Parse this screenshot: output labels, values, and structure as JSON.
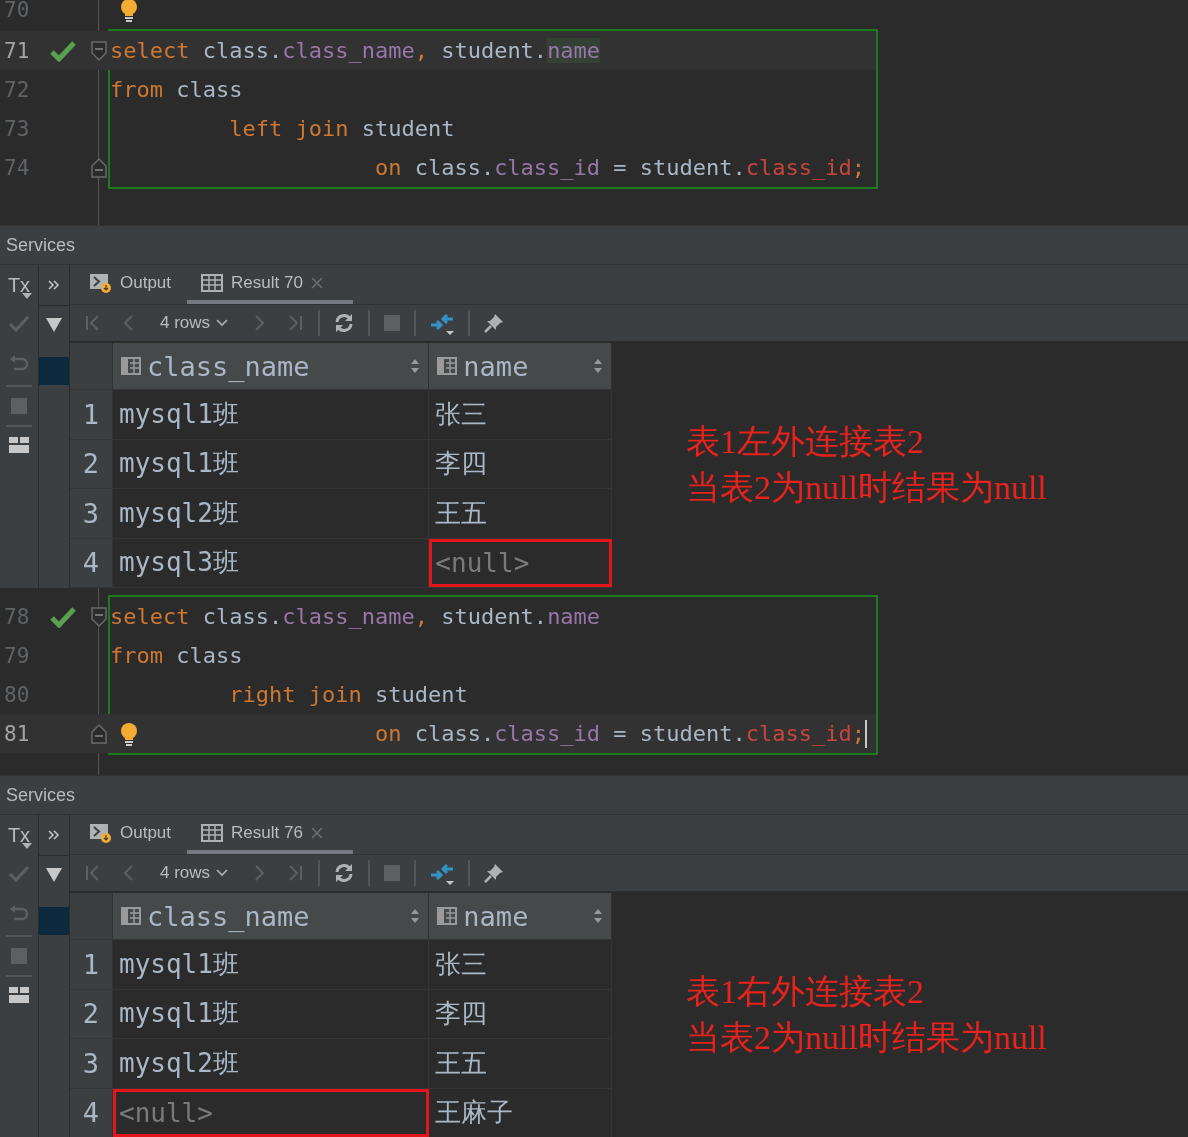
{
  "panels": [
    {
      "editor": {
        "before": [
          {
            "number": "70",
            "current": false,
            "executed": false,
            "hint": true,
            "fold_open": false,
            "fold_close": false,
            "caret": false
          }
        ],
        "statement": {
          "highlighted": true,
          "lines": [
            {
              "number": "71",
              "current": true,
              "executed": true,
              "hint": false,
              "fold_open": true,
              "fold_close": false,
              "caret": false,
              "tokens": [
                {
                  "kind": "keyword",
                  "text": "select"
                },
                {
                  "kind": "plain",
                  "text": " class."
                },
                {
                  "kind": "field",
                  "text": "class_name"
                },
                {
                  "kind": "keyword",
                  "text": ","
                },
                {
                  "kind": "plain",
                  "text": " student."
                },
                {
                  "kind": "field",
                  "text": "name",
                  "highlighted": true
                }
              ]
            },
            {
              "number": "72",
              "current": false,
              "executed": false,
              "hint": false,
              "fold_open": false,
              "fold_close": false,
              "caret": false,
              "tokens": [
                {
                  "kind": "keyword",
                  "text": "from"
                },
                {
                  "kind": "plain",
                  "text": " class"
                }
              ]
            },
            {
              "number": "73",
              "current": false,
              "executed": false,
              "hint": false,
              "fold_open": false,
              "fold_close": false,
              "caret": false,
              "tokens": [
                {
                  "kind": "keyword",
                  "text": "         left join"
                },
                {
                  "kind": "plain",
                  "text": " student"
                }
              ]
            },
            {
              "number": "74",
              "current": false,
              "executed": false,
              "hint": false,
              "fold_open": false,
              "fold_close": true,
              "caret": false,
              "tokens": [
                {
                  "kind": "keyword",
                  "text": "                    on"
                },
                {
                  "kind": "plain",
                  "text": " class."
                },
                {
                  "kind": "field",
                  "text": "class_id"
                },
                {
                  "kind": "plain",
                  "text": " = student."
                },
                {
                  "kind": "unresolved",
                  "text": "class_id"
                },
                {
                  "kind": "keyword",
                  "text": ";"
                }
              ]
            }
          ]
        }
      },
      "services": {
        "title": "Services",
        "side_label": "Tx",
        "tabs": [
          {
            "label": "Output",
            "kind": "output",
            "selected": false
          },
          {
            "label": "Result 70",
            "kind": "result",
            "selected": true
          }
        ],
        "toolbar": [
          {
            "kind": "first",
            "disabled": true
          },
          {
            "kind": "prev",
            "disabled": true
          },
          {
            "kind": "rows",
            "label": "4 rows",
            "disabled": false
          },
          {
            "kind": "next",
            "disabled": true
          },
          {
            "kind": "last",
            "disabled": true
          },
          {
            "kind": "refresh",
            "disabled": false
          },
          {
            "kind": "stop",
            "disabled": true
          },
          {
            "kind": "compare",
            "disabled": false
          },
          {
            "kind": "pin",
            "disabled": false
          }
        ],
        "table": {
          "columns": [
            "class_name",
            "name"
          ],
          "rows": [
            {
              "number": "1",
              "cells": [
                {
                  "text": "mysql1班",
                  "kind": "value",
                  "marked": false
                },
                {
                  "text": "张三",
                  "kind": "value",
                  "marked": false
                }
              ]
            },
            {
              "number": "2",
              "cells": [
                {
                  "text": "mysql1班",
                  "kind": "value",
                  "marked": false
                },
                {
                  "text": "李四",
                  "kind": "value",
                  "marked": false
                }
              ]
            },
            {
              "number": "3",
              "cells": [
                {
                  "text": "mysql2班",
                  "kind": "value",
                  "marked": false
                },
                {
                  "text": "王五",
                  "kind": "value",
                  "marked": false
                }
              ]
            },
            {
              "number": "4",
              "cells": [
                {
                  "text": "mysql3班",
                  "kind": "value",
                  "marked": false
                },
                {
                  "text": "<null>",
                  "kind": "null",
                  "marked": true
                }
              ]
            }
          ]
        },
        "annotation": [
          "表1左外连接表2",
          "当表2为null时结果为null"
        ]
      }
    },
    {
      "editor": {
        "statement": {
          "highlighted": true,
          "lines": [
            {
              "number": "78",
              "current": false,
              "executed": true,
              "hint": false,
              "fold_open": true,
              "fold_close": false,
              "caret": false,
              "tokens": [
                {
                  "kind": "keyword",
                  "text": "select"
                },
                {
                  "kind": "plain",
                  "text": " class."
                },
                {
                  "kind": "field",
                  "text": "class_name"
                },
                {
                  "kind": "keyword",
                  "text": ","
                },
                {
                  "kind": "plain",
                  "text": " student."
                },
                {
                  "kind": "field",
                  "text": "name"
                }
              ]
            },
            {
              "number": "79",
              "current": false,
              "executed": false,
              "hint": false,
              "fold_open": false,
              "fold_close": false,
              "caret": false,
              "tokens": [
                {
                  "kind": "keyword",
                  "text": "from"
                },
                {
                  "kind": "plain",
                  "text": " class"
                }
              ]
            },
            {
              "number": "80",
              "current": false,
              "executed": false,
              "hint": false,
              "fold_open": false,
              "fold_close": false,
              "caret": false,
              "tokens": [
                {
                  "kind": "keyword",
                  "text": "         right join"
                },
                {
                  "kind": "plain",
                  "text": " student"
                }
              ]
            },
            {
              "number": "81",
              "current": true,
              "executed": false,
              "hint": true,
              "fold_open": false,
              "fold_close": true,
              "caret": true,
              "tokens": [
                {
                  "kind": "keyword",
                  "text": "                    on"
                },
                {
                  "kind": "plain",
                  "text": " class."
                },
                {
                  "kind": "field",
                  "text": "class_id"
                },
                {
                  "kind": "plain",
                  "text": " = student."
                },
                {
                  "kind": "unresolved",
                  "text": "class_id"
                },
                {
                  "kind": "keyword",
                  "text": ";"
                }
              ]
            }
          ]
        }
      },
      "services": {
        "title": "Services",
        "side_label": "Tx",
        "tabs": [
          {
            "label": "Output",
            "kind": "output",
            "selected": false
          },
          {
            "label": "Result 76",
            "kind": "result",
            "selected": true
          }
        ],
        "toolbar": [
          {
            "kind": "first",
            "disabled": true
          },
          {
            "kind": "prev",
            "disabled": true
          },
          {
            "kind": "rows",
            "label": "4 rows",
            "disabled": false
          },
          {
            "kind": "next",
            "disabled": true
          },
          {
            "kind": "last",
            "disabled": true
          },
          {
            "kind": "refresh",
            "disabled": false
          },
          {
            "kind": "stop",
            "disabled": true
          },
          {
            "kind": "compare",
            "disabled": false
          },
          {
            "kind": "pin",
            "disabled": false
          }
        ],
        "table": {
          "columns": [
            "class_name",
            "name"
          ],
          "rows": [
            {
              "number": "1",
              "cells": [
                {
                  "text": "mysql1班",
                  "kind": "value",
                  "marked": false
                },
                {
                  "text": "张三",
                  "kind": "value",
                  "marked": false
                }
              ]
            },
            {
              "number": "2",
              "cells": [
                {
                  "text": "mysql1班",
                  "kind": "value",
                  "marked": false
                },
                {
                  "text": "李四",
                  "kind": "value",
                  "marked": false
                }
              ]
            },
            {
              "number": "3",
              "cells": [
                {
                  "text": "mysql2班",
                  "kind": "value",
                  "marked": false
                },
                {
                  "text": "王五",
                  "kind": "value",
                  "marked": false
                }
              ]
            },
            {
              "number": "4",
              "cells": [
                {
                  "text": "<null>",
                  "kind": "null",
                  "marked": true
                },
                {
                  "text": "王麻子",
                  "kind": "value",
                  "marked": false
                }
              ]
            }
          ]
        },
        "annotation": [
          "表1右外连接表2",
          "当表2为null时结果为null"
        ]
      }
    }
  ]
}
